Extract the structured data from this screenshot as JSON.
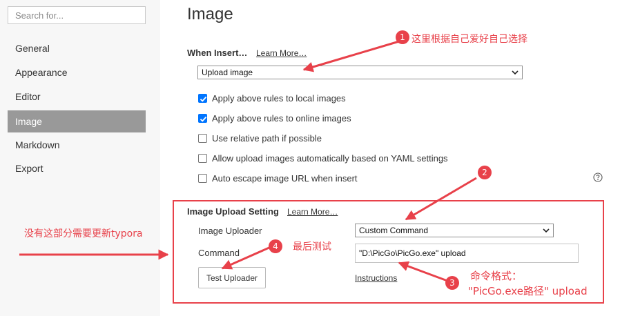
{
  "sidebar": {
    "search_placeholder": "Search for...",
    "items": [
      {
        "label": "General"
      },
      {
        "label": "Appearance"
      },
      {
        "label": "Editor"
      },
      {
        "label": "Image"
      },
      {
        "label": "Markdown"
      },
      {
        "label": "Export"
      }
    ],
    "active_item": "Image"
  },
  "main": {
    "title": "Image",
    "when_insert": {
      "label": "When Insert…",
      "learn_more": "Learn More…",
      "selected": "Upload image"
    },
    "options": [
      {
        "label": "Apply above rules to local images",
        "checked": true
      },
      {
        "label": "Apply above rules to online images",
        "checked": true
      },
      {
        "label": "Use relative path if possible",
        "checked": false
      },
      {
        "label": "Allow upload images automatically based on YAML settings",
        "checked": false
      },
      {
        "label": "Auto escape image URL when insert",
        "checked": false
      }
    ],
    "help_icon": "question-circle-icon",
    "upload_setting": {
      "title": "Image Upload Setting",
      "learn_more": "Learn More…",
      "uploader_label": "Image Uploader",
      "uploader_selected": "Custom Command",
      "command_label": "Command",
      "command_value": "\"D:\\PicGo\\PicGo.exe\" upload",
      "test_button": "Test Uploader",
      "instructions_link": "Instructions"
    }
  },
  "annotations": {
    "badge_1": "1",
    "note_1": "这里根据自己爱好自己选择",
    "badge_2": "2",
    "badge_3": "3",
    "note_3_line1": "命令格式：",
    "note_3_line2": "\"PicGo.exe路径\" upload",
    "badge_4": "4",
    "note_4": "最后测试",
    "note_left": "没有这部分需要更新typora"
  },
  "colors": {
    "accent_blue": "#0075ff",
    "annotation_red": "#e8414a",
    "sidebar_bg": "#f7f7f7",
    "active_item_bg": "#999999"
  }
}
